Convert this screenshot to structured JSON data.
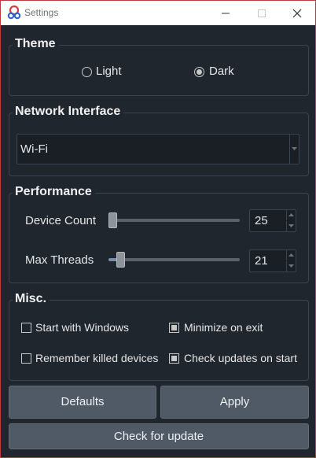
{
  "window": {
    "title": "Settings"
  },
  "theme": {
    "title": "Theme",
    "options": [
      {
        "label": "Light",
        "selected": false
      },
      {
        "label": "Dark",
        "selected": true
      }
    ]
  },
  "network": {
    "title": "Network Interface",
    "selected": "Wi-Fi"
  },
  "performance": {
    "title": "Performance",
    "device_count": {
      "label": "Device Count",
      "value": "25"
    },
    "max_threads": {
      "label": "Max Threads",
      "value": "21"
    }
  },
  "misc": {
    "title": "Misc.",
    "options": [
      {
        "label": "Start with Windows",
        "checked": false
      },
      {
        "label": "Minimize on exit",
        "checked": true
      },
      {
        "label": "Remember killed devices",
        "checked": false
      },
      {
        "label": "Check updates on start",
        "checked": true
      }
    ]
  },
  "buttons": {
    "defaults": "Defaults",
    "apply": "Apply",
    "check_update": "Check for update"
  },
  "colors": {
    "background": "#20262e",
    "button": "#505a66",
    "border": "#3a4450",
    "window_border": "#c8383a"
  }
}
